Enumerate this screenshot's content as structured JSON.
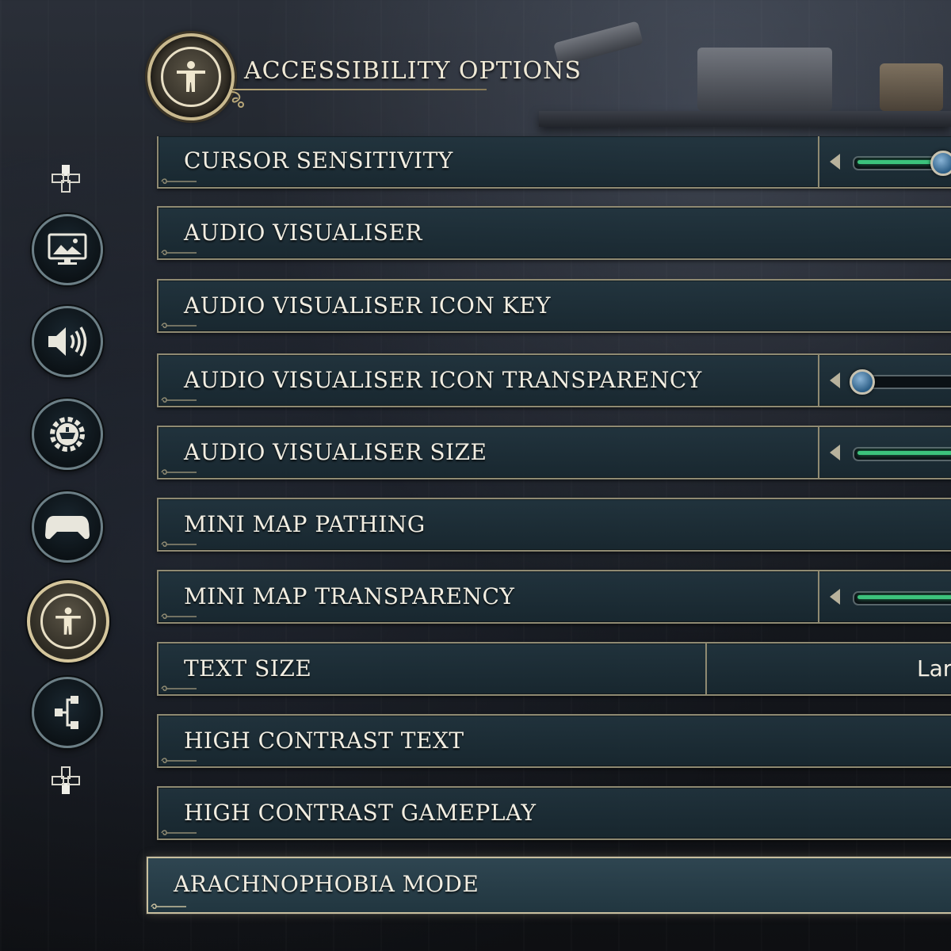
{
  "header": {
    "title": "ACCESSIBILITY OPTIONS",
    "icon": "accessibility-icon"
  },
  "sidebar": {
    "items": [
      {
        "name": "display",
        "icon": "monitor-icon",
        "active": false
      },
      {
        "name": "audio",
        "icon": "speaker-icon",
        "active": false
      },
      {
        "name": "gameplay",
        "icon": "gear-helmet-icon",
        "active": false
      },
      {
        "name": "controls",
        "icon": "gamepad-icon",
        "active": false
      },
      {
        "name": "accessibility",
        "icon": "accessibility-icon",
        "active": true
      },
      {
        "name": "social",
        "icon": "share-icon",
        "active": false
      }
    ],
    "top_hint_icon": "dpad-up-icon",
    "bottom_hint_icon": "dpad-down-icon"
  },
  "options": [
    {
      "label": "CURSOR SENSITIVITY",
      "control": "slider",
      "value_fraction": 1.0
    },
    {
      "label": "AUDIO VISUALISER",
      "control": "none"
    },
    {
      "label": "AUDIO VISUALISER ICON KEY",
      "control": "none"
    },
    {
      "label": "AUDIO VISUALISER ICON TRANSPARENCY",
      "control": "slider",
      "value_fraction": 0.0
    },
    {
      "label": "AUDIO VISUALISER SIZE",
      "control": "slider",
      "value_fraction": 1.0
    },
    {
      "label": "MINI MAP PATHING",
      "control": "none"
    },
    {
      "label": "MINI MAP TRANSPARENCY",
      "control": "slider",
      "value_fraction": 1.0
    },
    {
      "label": "TEXT SIZE",
      "control": "select",
      "value": "Lar"
    },
    {
      "label": "HIGH CONTRAST TEXT",
      "control": "none"
    },
    {
      "label": "HIGH CONTRAST GAMEPLAY",
      "control": "none"
    },
    {
      "label": "ARACHNOPHOBIA MODE",
      "control": "none",
      "selected": true
    }
  ],
  "colors": {
    "slider_fill": "#3cc27c",
    "row_border": "#8f8a72",
    "gold_trim": "#c9b98e"
  }
}
